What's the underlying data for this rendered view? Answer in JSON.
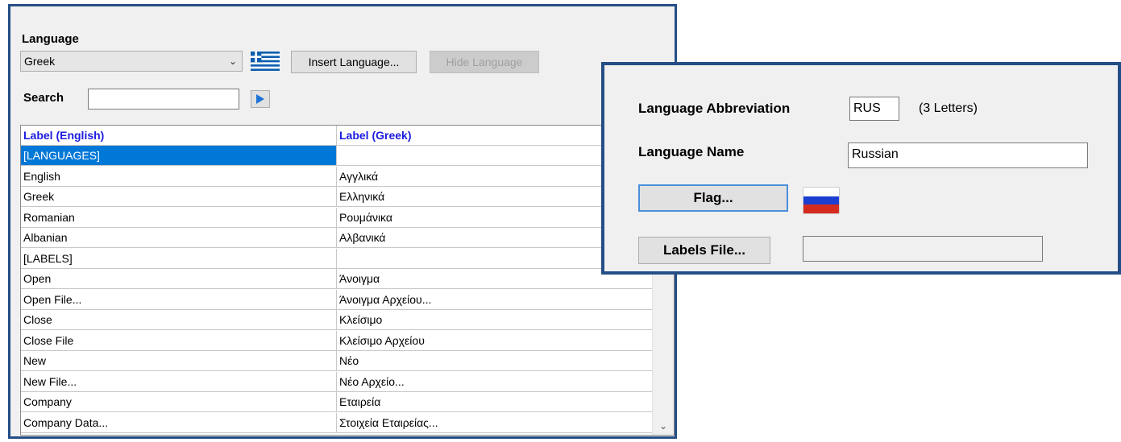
{
  "language_panel": {
    "language_label": "Language",
    "selected_language": "Greek",
    "insert_button": "Insert Language...",
    "hide_button": "Hide Language",
    "search_label": "Search",
    "search_value": ""
  },
  "grid": {
    "columns": [
      "Label (English)",
      "Label (Greek)"
    ],
    "rows": [
      [
        "[LANGUAGES]",
        ""
      ],
      [
        "English",
        "Αγγλικά"
      ],
      [
        "Greek",
        "Ελληνικά"
      ],
      [
        "Romanian",
        "Ρουμάνικα"
      ],
      [
        "Albanian",
        "Αλβανικά"
      ],
      [
        "[LABELS]",
        ""
      ],
      [
        "Open",
        "Άνοιγμα"
      ],
      [
        "Open File...",
        "Άνοιγμα Αρχείου..."
      ],
      [
        "Close",
        "Κλείσιμο"
      ],
      [
        "Close File",
        "Κλείσιμο Αρχείου"
      ],
      [
        "New",
        "Νέο"
      ],
      [
        "New File...",
        "Νέο Αρχείο..."
      ],
      [
        "Company",
        "Εταιρεία"
      ],
      [
        "Company Data...",
        "Στοιχεία Εταιρείας..."
      ]
    ]
  },
  "insert_panel": {
    "abbrev_label": "Language Abbreviation",
    "abbrev_value": "RUS",
    "abbrev_hint": "(3 Letters)",
    "name_label": "Language Name",
    "name_value": "Russian",
    "flag_button": "Flag...",
    "labels_file_button": "Labels File...",
    "labels_file_value": ""
  },
  "colors": {
    "window_border": "#254e86",
    "header_text": "#1b1be0",
    "selection": "#0078d7"
  },
  "icons": {
    "dropdown": "chevron-down-icon",
    "go": "play-arrow-icon",
    "scroll_down": "scroll-down-arrow-icon",
    "greek_flag": "greek-flag-icon",
    "russian_flag": "russian-flag-icon"
  }
}
